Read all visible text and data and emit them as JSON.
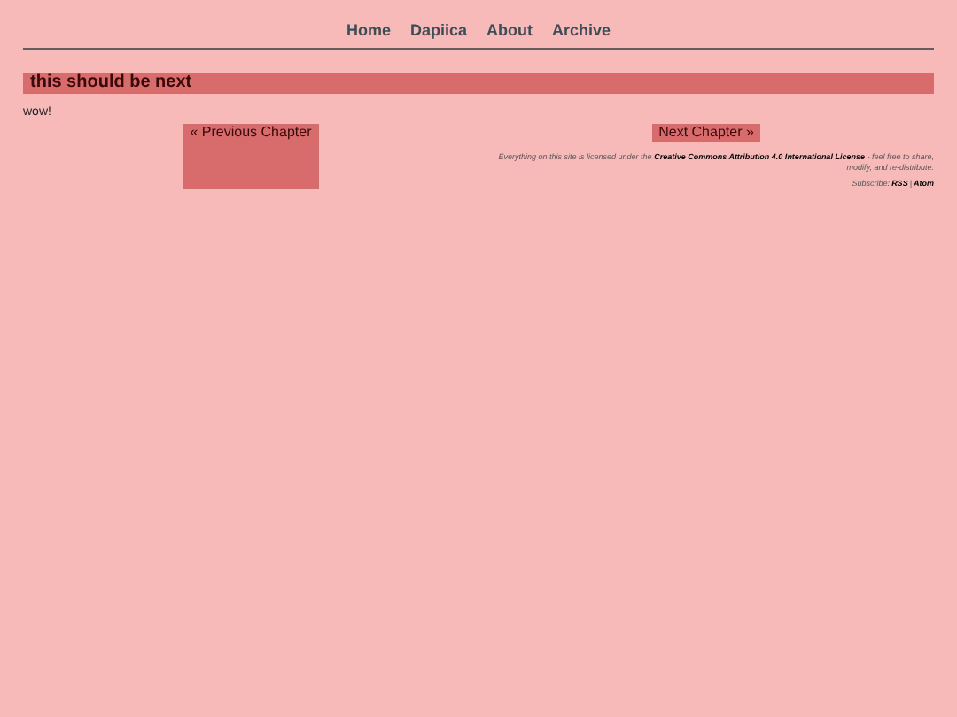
{
  "nav": [
    "Home",
    "Dapiica",
    "About",
    "Archive"
  ],
  "post": {
    "title": "this should be next",
    "body": "wow!"
  },
  "pager": {
    "previous": "« Previous Chapter",
    "next": "Next Chapter »"
  },
  "footer": {
    "license_before": "Everything on this site is licensed under the",
    "license_link": "Creative Commons Attribution 4.0 International License",
    "license_after": "- feel free to share, modify, and re-distribute.",
    "subscribe_label": "Subscribe:",
    "feeds": [
      "RSS",
      "Atom"
    ],
    "separator": "|"
  }
}
